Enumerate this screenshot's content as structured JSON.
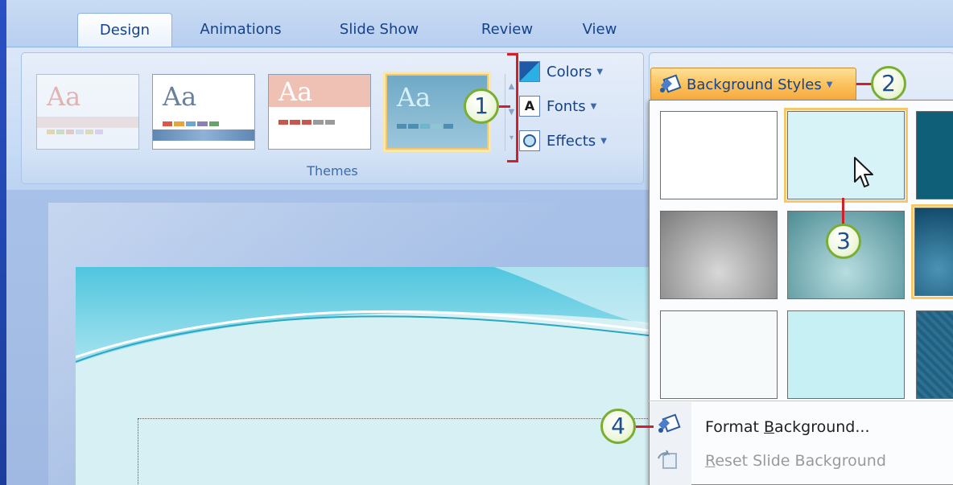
{
  "ribbon": {
    "tabs": [
      {
        "label": "Design",
        "active": true
      },
      {
        "label": "Animations",
        "active": false
      },
      {
        "label": "Slide Show",
        "active": false
      },
      {
        "label": "Review",
        "active": false
      },
      {
        "label": "View",
        "active": false
      }
    ],
    "themes_group": {
      "label": "Themes",
      "thumbnail_text": "Aa",
      "commands": {
        "colors": "Colors",
        "fonts": "Fonts",
        "effects": "Effects"
      }
    },
    "background_styles_button": "Background Styles"
  },
  "callouts": [
    "1",
    "2",
    "3",
    "4"
  ],
  "dropdown": {
    "format_background": {
      "before": "Format ",
      "underline": "B",
      "after": "ackground..."
    },
    "reset_slide_background": {
      "underline": "R",
      "after": "eset Slide Background"
    }
  },
  "icons": [
    "colors-icon",
    "fonts-icon",
    "effects-icon",
    "background-styles-icon",
    "format-background-icon",
    "reset-background-icon",
    "mouse-cursor-icon"
  ],
  "colors": {
    "ribbon_text": "#15428b",
    "callout_line": "#d0202a",
    "callout_ring": "#7aae33",
    "highlight": "#f7c86a",
    "disabled_text": "#9a9a9a"
  }
}
